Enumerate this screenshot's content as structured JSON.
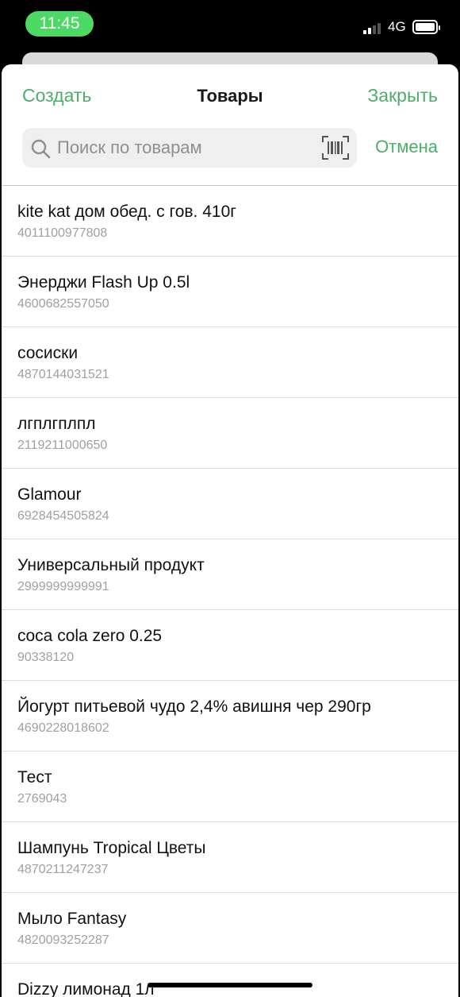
{
  "status_bar": {
    "time": "11:45",
    "network": "4G",
    "accent_color": "#4cd964"
  },
  "nav": {
    "left_label": "Создать",
    "title": "Товары",
    "right_label": "Закрыть",
    "accent_color": "#4cae6a"
  },
  "search": {
    "placeholder": "Поиск по товарам",
    "value": "",
    "cancel_label": "Отмена",
    "icon": "search-icon",
    "barcode_icon": "barcode-scan-icon"
  },
  "products": [
    {
      "name": "kite kat дом обед. с гов. 410г",
      "code": "4011100977808"
    },
    {
      "name": "Энерджи Flash Up 0.5l",
      "code": "4600682557050"
    },
    {
      "name": "сосиски",
      "code": "4870144031521"
    },
    {
      "name": "лгплгплпл",
      "code": "2119211000650"
    },
    {
      "name": "Glamour",
      "code": "6928454505824"
    },
    {
      "name": "Универсальный продукт",
      "code": "2999999999991"
    },
    {
      "name": "coca cola zero 0.25",
      "code": "90338120"
    },
    {
      "name": "Йогурт питьевой чудо 2,4% авишня чер 290гр",
      "code": "4690228018602"
    },
    {
      "name": "Тест",
      "code": "2769043"
    },
    {
      "name": "Шампунь Tropical Цветы",
      "code": "4870211247237"
    },
    {
      "name": "Мыло Fantasy",
      "code": "4820093252287"
    },
    {
      "name": "Dizzy лимонад 1л",
      "code": ""
    }
  ]
}
